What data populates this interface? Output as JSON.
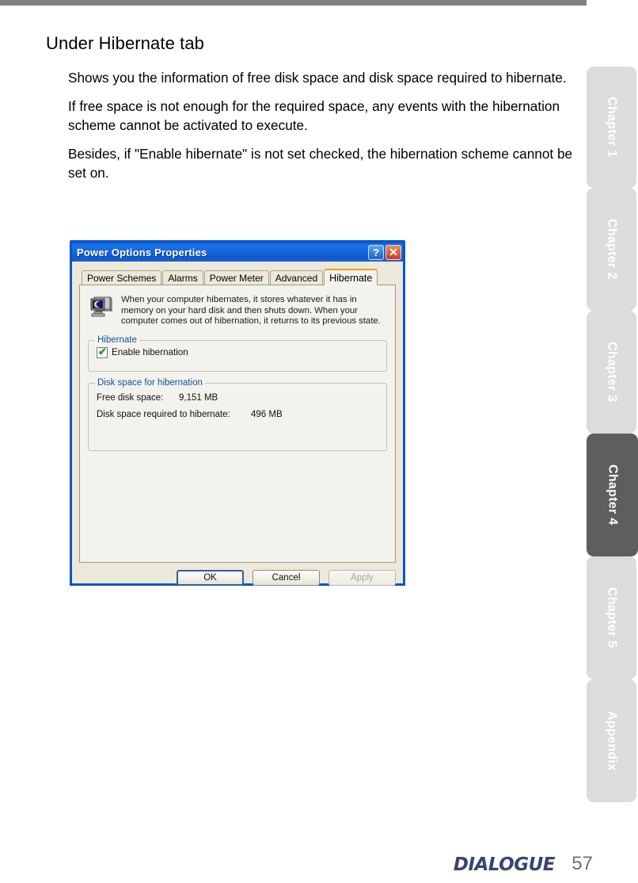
{
  "document": {
    "heading": "Under Hibernate tab",
    "paragraphs": [
      "Shows you the information of free disk space and disk space required to hibernate.",
      "If free space is not enough for the required space, any events with the hibernation scheme cannot be activated to execute.",
      "Besides, if \"Enable hibernate\" is not set checked, the hibernation scheme cannot be set on."
    ]
  },
  "dialog": {
    "title": "Power Options Properties",
    "titlebar_buttons": {
      "help": "?",
      "close": "✕"
    },
    "tabs": [
      {
        "label": "Power Schemes",
        "active": false
      },
      {
        "label": "Alarms",
        "active": false
      },
      {
        "label": "Power Meter",
        "active": false
      },
      {
        "label": "Advanced",
        "active": false
      },
      {
        "label": "Hibernate",
        "active": true
      }
    ],
    "intro_text": "When your computer hibernates, it stores whatever it has in memory on your hard disk and then shuts down. When your computer comes out of hibernation, it returns to its previous state.",
    "hibernate_group": {
      "title": "Hibernate",
      "checkbox_label": "Enable hibernation",
      "checkbox_checked": true,
      "check_glyph": "✔"
    },
    "disk_group": {
      "title": "Disk space for hibernation",
      "rows": [
        {
          "label": "Free disk space:",
          "value": "9,151 MB"
        },
        {
          "label": "Disk space required to hibernate:",
          "value": "496 MB"
        }
      ]
    },
    "buttons": [
      {
        "label": "OK",
        "state": "focused"
      },
      {
        "label": "Cancel",
        "state": "normal"
      },
      {
        "label": "Apply",
        "state": "disabled"
      }
    ],
    "colors": {
      "titlebar_blue": "#1768dd",
      "frame_border": "#0a55c8",
      "panel_bg": "#f4f2ec",
      "chrome_bg": "#ece9d8",
      "group_title_blue": "#12509e",
      "active_tab_accent": "#f0a000",
      "check_green": "#1a9b2a",
      "close_red": "#d1391a"
    }
  },
  "rail": {
    "chips": [
      {
        "label": "Chapter 1",
        "active": false
      },
      {
        "label": "Chapter 2",
        "active": false
      },
      {
        "label": "Chapter 3",
        "active": false
      },
      {
        "label": "Chapter 4",
        "active": true
      },
      {
        "label": "Chapter 5",
        "active": false
      },
      {
        "label": "Appendix",
        "active": false
      }
    ],
    "colors": {
      "inactive": "#dcdcdc",
      "active": "#5e5e5e",
      "label": "#ffffff"
    }
  },
  "footer": {
    "logo": "DIALOGUE",
    "page_number": "57",
    "colors": {
      "logo": "#3b4272",
      "page_number": "#6f6f6f"
    }
  }
}
